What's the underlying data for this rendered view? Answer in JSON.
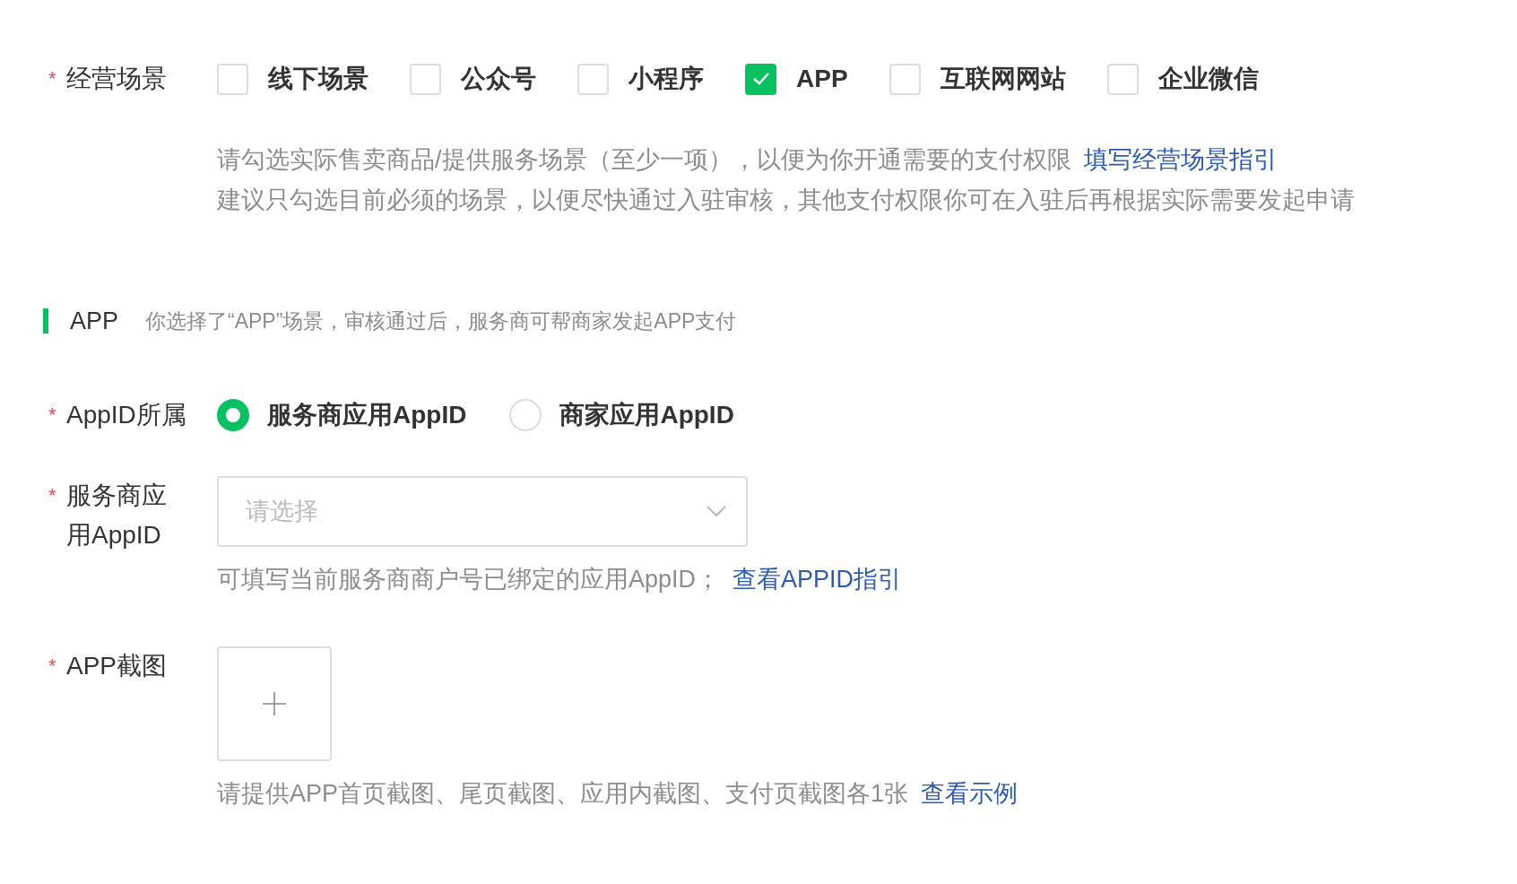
{
  "business_scene": {
    "mark": "*",
    "label": "经营场景",
    "options": [
      {
        "label": "线下场景",
        "checked": false
      },
      {
        "label": "公众号",
        "checked": false
      },
      {
        "label": "小程序",
        "checked": false
      },
      {
        "label": "APP",
        "checked": true
      },
      {
        "label": "互联网网站",
        "checked": false
      },
      {
        "label": "企业微信",
        "checked": false
      }
    ],
    "hints": [
      {
        "text": "请勾选实际售卖商品/提供服务场景（至少一项），以便为你开通需要的支付权限",
        "link": "填写经营场景指引"
      },
      {
        "text": "建议只勾选目前必须的场景，以便尽快通过入驻审核，其他支付权限你可在入驻后再根据实际需要发起申请"
      }
    ]
  },
  "section": {
    "title": "APP",
    "description": "你选择了“APP”场景，审核通过后，服务商可帮商家发起APP支付"
  },
  "appid_owner": {
    "mark": "*",
    "label": "AppID所属",
    "options": [
      {
        "label": "服务商应用AppID",
        "selected": true
      },
      {
        "label": "商家应用AppID",
        "selected": false
      }
    ]
  },
  "provider_appid": {
    "mark": "*",
    "label": "服务商应用AppID",
    "placeholder": "请选择",
    "hint": {
      "text": "可填写当前服务商商户号已绑定的应用AppID；",
      "link": "查看APPID指引"
    }
  },
  "app_screenshot": {
    "mark": "*",
    "label": "APP截图",
    "hint": {
      "text": "请提供APP首页截图、尾页截图、应用内截图、支付页截图各1张",
      "link": "查看示例"
    }
  }
}
